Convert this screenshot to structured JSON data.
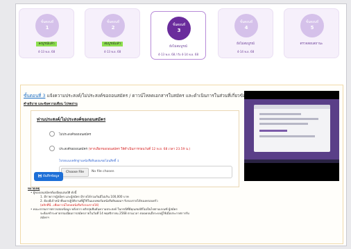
{
  "steps": [
    {
      "label": "ขั้นตอนที่",
      "number": "1",
      "status": "ลงบูรณ์แล้ว",
      "state": "done",
      "date": "4-13 พ.ย. 68"
    },
    {
      "label": "ขั้นตอนที่",
      "number": "2",
      "status": "สมบูรณ์แล้ว",
      "state": "done",
      "date": "4-13 พ.ย. 68"
    },
    {
      "label": "ขั้นตอนที่",
      "number": "3",
      "status": "ยังไม่สมบูรณ์",
      "state": "pending",
      "date": "4-13 พ.ย. 68 / ถึง 4-14 พ.ย. 68"
    },
    {
      "label": "ขั้นตอนที่",
      "number": "4",
      "status": "ยังไม่สมบูรณ์",
      "state": "pending",
      "date": "4-14 พ.ย. 68"
    },
    {
      "label": "ขั้นตอนที่",
      "number": "5",
      "status": "ตรวจสอบสถานะ",
      "state": "pending",
      "date": ""
    }
  ],
  "main": {
    "headline_step": "ขั้นตอนที่ 3",
    "headline_text": "แจ้งความประสงค์/ไม่ประสงค์ขอถอนสมัคร / ดาวน์โหลดเอกสารใบสมัคร และดำเนินการในส่วนที่เกี่ยวข้อง",
    "sublink": "คำอธิบาย และข้อความเตือน โปรดอ่าน"
  },
  "form": {
    "title": "ท่านประสงค์/ไม่ประสงค์ขอถอนสมัคร",
    "option1": "ไม่ประสงค์ขอถอนสมัคร",
    "option2": "ประสงค์ขอถอนสมัคร",
    "option2_note": "(หากเลือกขอถอนสมัคร ให้ดำเนินการก่อนวันที่ 12 พ.ย. 68 เวลา 23.59 น.)",
    "upload_link": "โปรดแนบหลักฐานหนังสือยินยอมขอโอนสิทธิ์",
    "file_button": "Choose File",
    "file_status": "No file chosen",
    "save_label": "บันทึกข้อมูล"
  },
  "notes": {
    "title": "หมายเหตุ",
    "line1": "• ผู้ขอถอนสมัครต้องมีคุณสมบัติ ดังนี้",
    "line2": "1. มีรายการผู้สมัคร และผู้สมัคร มีรายได้รวมกันมีไม่เกิน 100,000 บาท",
    "line3": "2. ต้องมีเจ้าหน้าที่ออกปฏิบัติงานที่ผู้ใช้ในแบบฟอร์มหนังสือยินยอมฯ รับรองรายได้ของครอบครัว",
    "line4_link": "(คลิกที่นี่...เพื่อดาวน์โหลดหนังสือรับรองรายได้)",
    "line5": "• คณะกรรมการตรวจสอบข้อมูล หลังจาก คลิกปุ่มยืนยันความประสงค์ ในกรณีที่มีคุณสมบัติไม่เป็นไปตามเกณฑ์ ผู้สมัคร",
    "line6": "จะต้องชำระค่าธรรมเนียมการสมัครภายในวันที่ 14 พฤศจิกายน 2568 ตามเวลา ตลอดจนถึงระบบผู้ใช้เมื่อประกาศการรับ",
    "line7": "สมัครฯ"
  },
  "colors": {
    "accent_purple": "#6a2c9c",
    "done_green": "#8ddf4f",
    "primary_blue": "#1d6fd7",
    "warning_red": "#d62020"
  }
}
